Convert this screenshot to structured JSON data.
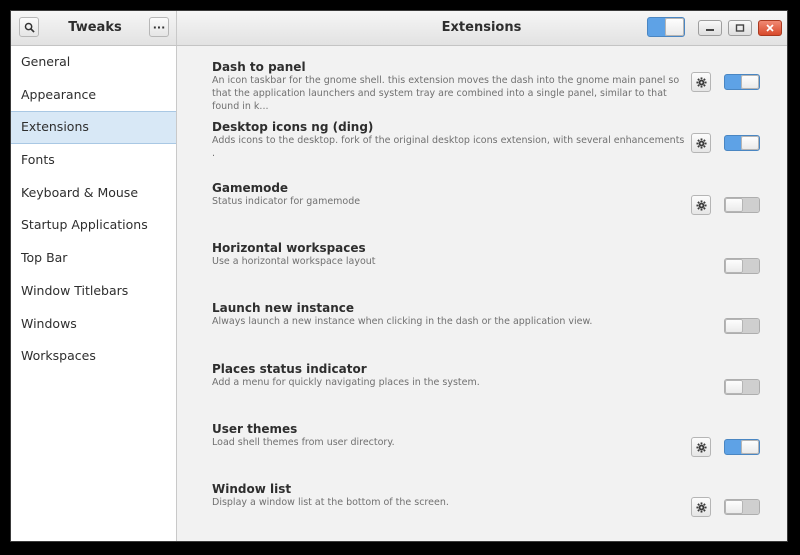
{
  "app": {
    "sidebar_title": "Tweaks",
    "main_title": "Extensions",
    "menu_glyph": "···",
    "global_switch_on": true
  },
  "sidebar": {
    "items": [
      {
        "label": "General",
        "selected": false
      },
      {
        "label": "Appearance",
        "selected": false
      },
      {
        "label": "Extensions",
        "selected": true
      },
      {
        "label": "Fonts",
        "selected": false
      },
      {
        "label": "Keyboard & Mouse",
        "selected": false
      },
      {
        "label": "Startup Applications",
        "selected": false
      },
      {
        "label": "Top Bar",
        "selected": false
      },
      {
        "label": "Window Titlebars",
        "selected": false
      },
      {
        "label": "Windows",
        "selected": false
      },
      {
        "label": "Workspaces",
        "selected": false
      }
    ]
  },
  "extensions": [
    {
      "title": "Dash to panel",
      "description": "An icon taskbar for the gnome shell. this extension moves the dash into the gnome main panel so that the application launchers and system tray are combined into a single panel, similar to that found in k...",
      "has_settings": true,
      "enabled": true
    },
    {
      "title": "Desktop icons ng (ding)",
      "description": "Adds icons to the desktop. fork of the original desktop icons extension, with several enhancements .",
      "has_settings": true,
      "enabled": true
    },
    {
      "title": "Gamemode",
      "description": "Status indicator for gamemode",
      "has_settings": true,
      "enabled": false
    },
    {
      "title": "Horizontal workspaces",
      "description": "Use a horizontal workspace layout",
      "has_settings": false,
      "enabled": false
    },
    {
      "title": "Launch new instance",
      "description": "Always launch a new instance when clicking in the dash or the application view.",
      "has_settings": false,
      "enabled": false
    },
    {
      "title": "Places status indicator",
      "description": "Add a menu for quickly navigating places in the system.",
      "has_settings": false,
      "enabled": false
    },
    {
      "title": "User themes",
      "description": "Load shell themes from user directory.",
      "has_settings": true,
      "enabled": true
    },
    {
      "title": "Window list",
      "description": "Display a window list at the bottom of the screen.",
      "has_settings": true,
      "enabled": false
    }
  ],
  "colors": {
    "accent": "#5ea2e6",
    "selection": "#d8e8f6",
    "close_button": "#d84a2b"
  },
  "icons": {
    "search": "search-icon",
    "menu": "more-icon",
    "settings": "gear-icon",
    "minimize": "minimize-icon",
    "maximize": "maximize-icon",
    "close": "close-icon"
  }
}
